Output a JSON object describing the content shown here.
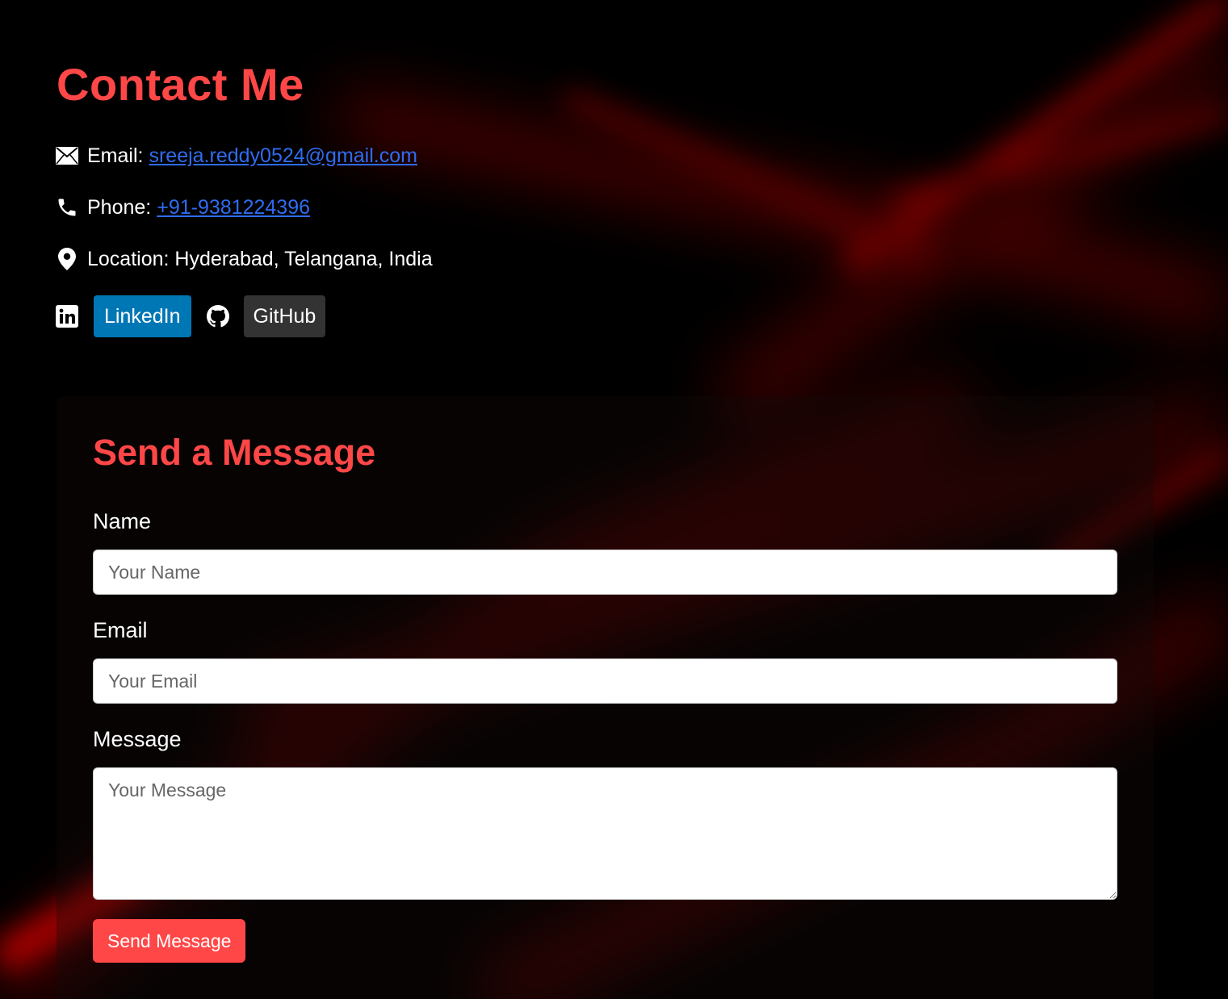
{
  "header": {
    "title": "Contact Me"
  },
  "contact": {
    "email_label": "Email:",
    "email_value": "sreeja.reddy0524@gmail.com",
    "phone_label": "Phone:",
    "phone_value": "+91-9381224396",
    "location_text": "Location: Hyderabad, Telangana, India"
  },
  "social": {
    "linkedin_label": "LinkedIn",
    "github_label": "GitHub"
  },
  "form": {
    "title": "Send a Message",
    "name_label": "Name",
    "name_placeholder": "Your Name",
    "email_label": "Email",
    "email_placeholder": "Your Email",
    "message_label": "Message",
    "message_placeholder": "Your Message",
    "submit_label": "Send Message"
  },
  "colors": {
    "accent": "#ff4747",
    "link": "#2f6cf0",
    "linkedin": "#0077b5",
    "github": "#333333",
    "background": "#000000"
  },
  "icons": [
    "envelope-icon",
    "phone-icon",
    "location-pin-icon",
    "linkedin-icon",
    "github-icon"
  ]
}
